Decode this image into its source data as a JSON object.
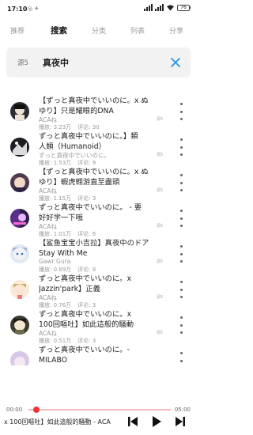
{
  "status_bar": {
    "time": "17:10",
    "note": "◎ ✈",
    "battery": "76"
  },
  "tabs": [
    "推荐",
    "搜索",
    "分类",
    "列表",
    "分享"
  ],
  "search": {
    "source": "源5",
    "query": "真夜中"
  },
  "results": [
    {
      "title_line1": "【ずっと真夜中でいいのに。x ぬ",
      "title_line2": "ゆり】只是耀眼的DNA",
      "artist": "ACAね",
      "plays": "播放: 3.23万",
      "comments": "评论: 30",
      "source_badge": "源5"
    },
    {
      "title_line1": "ずっと真夜中でいいのに。】類",
      "title_line2": "人類（Humanoid）",
      "artist": "ずっと真夜中でいいのに。",
      "plays": "播放: 1.53万",
      "comments": "评论: 9",
      "source_badge": "源5"
    },
    {
      "title_line1": "【ずっと真夜中でいいのに。x ぬ",
      "title_line2": "ゆり】蝦虎翱游直至盡頭",
      "artist": "ACAね",
      "plays": "播放: 1.15万",
      "comments": "评论: 3",
      "source_badge": "源5"
    },
    {
      "title_line1": "ずっと真夜中でいいのに。 - 要",
      "title_line2": "好好学一下哦",
      "artist": "ACAね",
      "plays": "播放: 1.01万",
      "comments": "评论: 6",
      "source_badge": "源5"
    },
    {
      "title_line1": "【鲨鱼宝宝小吉拉】真夜中のドア",
      "title_line2": "Stay With Me",
      "artist": "Gawr Gura",
      "plays": "播放: 0.89万",
      "comments": "评论: 8",
      "source_badge": "源5"
    },
    {
      "title_line1": "ずっと真夜中でいいのに。x",
      "title_line2": "Jazzin'park】正義",
      "artist": "ACAね",
      "plays": "播放: 0.76万",
      "comments": "评论: 3",
      "source_badge": "源5"
    },
    {
      "title_line1": "ずっと真夜中でいいのに。x",
      "title_line2": "100回嘔吐】如此這般的騒動",
      "artist": "ACAね",
      "plays": "播放: 0.51万",
      "comments": "评论: 3",
      "source_badge": "源5"
    },
    {
      "title_line1": "ずっと真夜中でいいのに。-",
      "title_line2": "MILABO",
      "artist": "",
      "plays": "",
      "comments": "",
      "source_badge": ""
    }
  ],
  "player": {
    "current_time": "00:00",
    "total_time": "05:00",
    "progress": 0.03,
    "now_playing": "x 100回嘔吐】如此這般的騒動 - ACA"
  },
  "colors": {
    "accent": "#e53935",
    "icon_blue": "#2196f3",
    "text_gray": "#999999"
  },
  "icons": [
    "signal-icon",
    "wifi-icon",
    "battery-icon",
    "clear-icon",
    "more-icon",
    "previous-icon",
    "play-icon",
    "next-icon"
  ]
}
